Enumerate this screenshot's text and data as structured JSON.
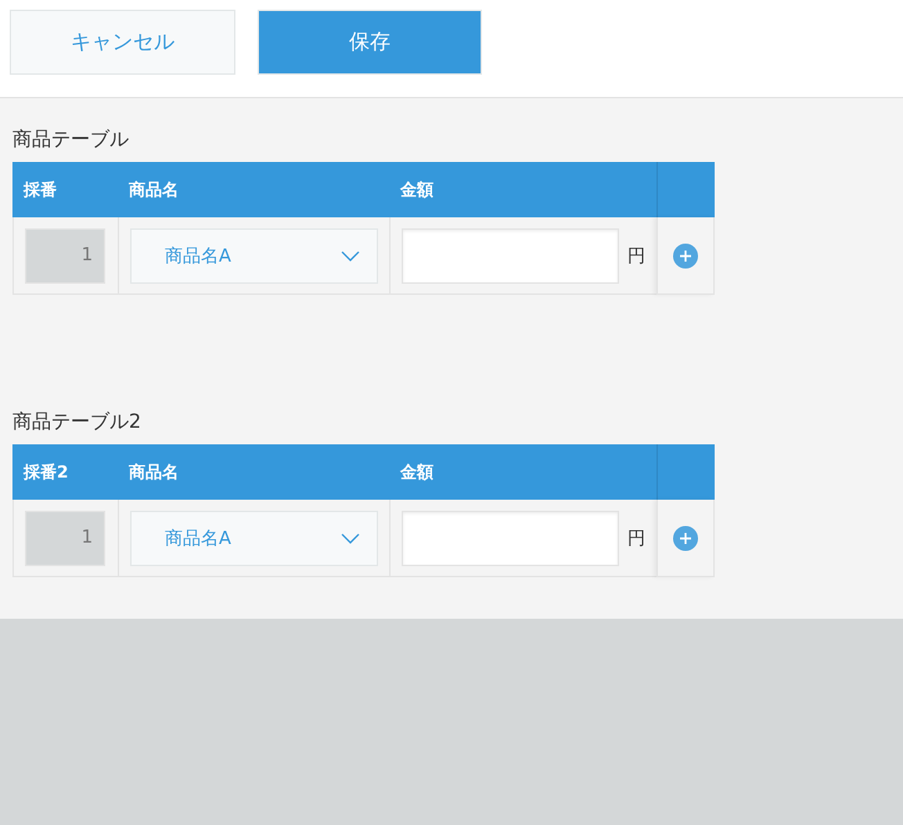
{
  "toolbar": {
    "buttons": [
      {
        "label": "キャンセル",
        "kind": "secondary"
      },
      {
        "label": "保存",
        "kind": "primary"
      }
    ]
  },
  "tables": [
    {
      "title": "商品テーブル",
      "columns": [
        "採番",
        "商品名",
        "金額"
      ],
      "rows": [
        {
          "number": "1",
          "product": "商品名A",
          "unit": "円"
        }
      ]
    },
    {
      "title": "商品テーブル2",
      "columns": [
        "採番2",
        "商品名",
        "金額"
      ],
      "rows": [
        {
          "number": "1",
          "product": "商品名A",
          "unit": "円"
        }
      ]
    }
  ]
}
